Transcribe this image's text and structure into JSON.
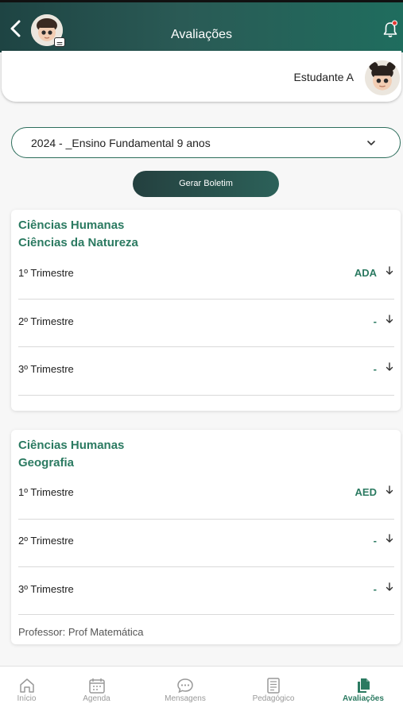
{
  "header": {
    "title": "Avaliações"
  },
  "student": {
    "name": "Estudante A"
  },
  "filter": {
    "year_value": "2024 - _Ensino Fundamental 9 anos"
  },
  "actions": {
    "gerar_label": "Gerar Boletim"
  },
  "cards": [
    {
      "area": "Ciências Humanas",
      "subject": "Ciências da Natureza",
      "rows": [
        {
          "label": "1º Trimestre",
          "value": "ADA"
        },
        {
          "label": "2º Trimestre",
          "value": "-"
        },
        {
          "label": "3º Trimestre",
          "value": "-"
        }
      ]
    },
    {
      "area": "Ciências Humanas",
      "subject": "Geografia",
      "rows": [
        {
          "label": "1º Trimestre",
          "value": "AED"
        },
        {
          "label": "2º Trimestre",
          "value": "-"
        },
        {
          "label": "3º Trimestre",
          "value": "-"
        }
      ],
      "professor": "Professor: Prof Matemática"
    }
  ],
  "nav": [
    {
      "label": "Início",
      "icon": "home-icon"
    },
    {
      "label": "Agenda",
      "icon": "calendar-icon"
    },
    {
      "label": "Mensagens",
      "icon": "chat-icon"
    },
    {
      "label": "Pedagógico",
      "icon": "document-icon"
    },
    {
      "label": "Avaliações",
      "icon": "files-icon",
      "active": true
    }
  ],
  "colors": {
    "accent": "#2b7a61",
    "header_dark": "#1e4443",
    "notification": "#e53935"
  }
}
